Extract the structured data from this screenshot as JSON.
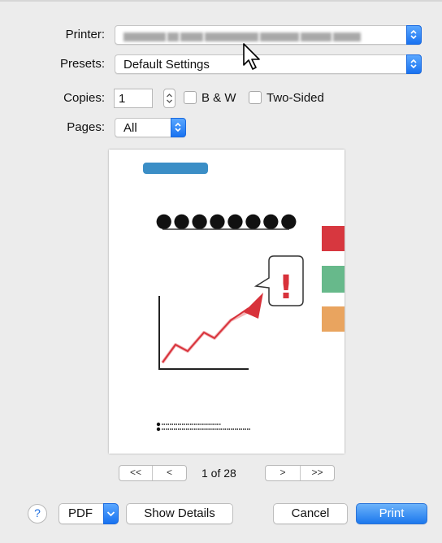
{
  "labels": {
    "printer": "Printer:",
    "presets": "Presets:",
    "copies": "Copies:",
    "pages": "Pages:"
  },
  "printer": {
    "value": ""
  },
  "presets": {
    "value": "Default Settings"
  },
  "copies": {
    "value": "1"
  },
  "options": {
    "bw_label": "B & W",
    "two_sided_label": "Two-Sided",
    "bw_checked": false,
    "two_sided_checked": false
  },
  "pages": {
    "value": "All"
  },
  "preview": {
    "header_dots": "●●●●●●●●",
    "alert_glyph": "!",
    "colors": {
      "bar_blue": "#3b8ec6",
      "red": "#d7373f",
      "green": "#67b98b",
      "orange": "#e9a45f",
      "arrow": "#d8323b"
    }
  },
  "pager": {
    "first": "<<",
    "prev": "<",
    "status": "1 of 28",
    "next": ">",
    "last": ">>"
  },
  "footer": {
    "help": "?",
    "pdf": "PDF",
    "show_details": "Show Details",
    "cancel": "Cancel",
    "print": "Print"
  },
  "accent_color": "#1c78ed"
}
